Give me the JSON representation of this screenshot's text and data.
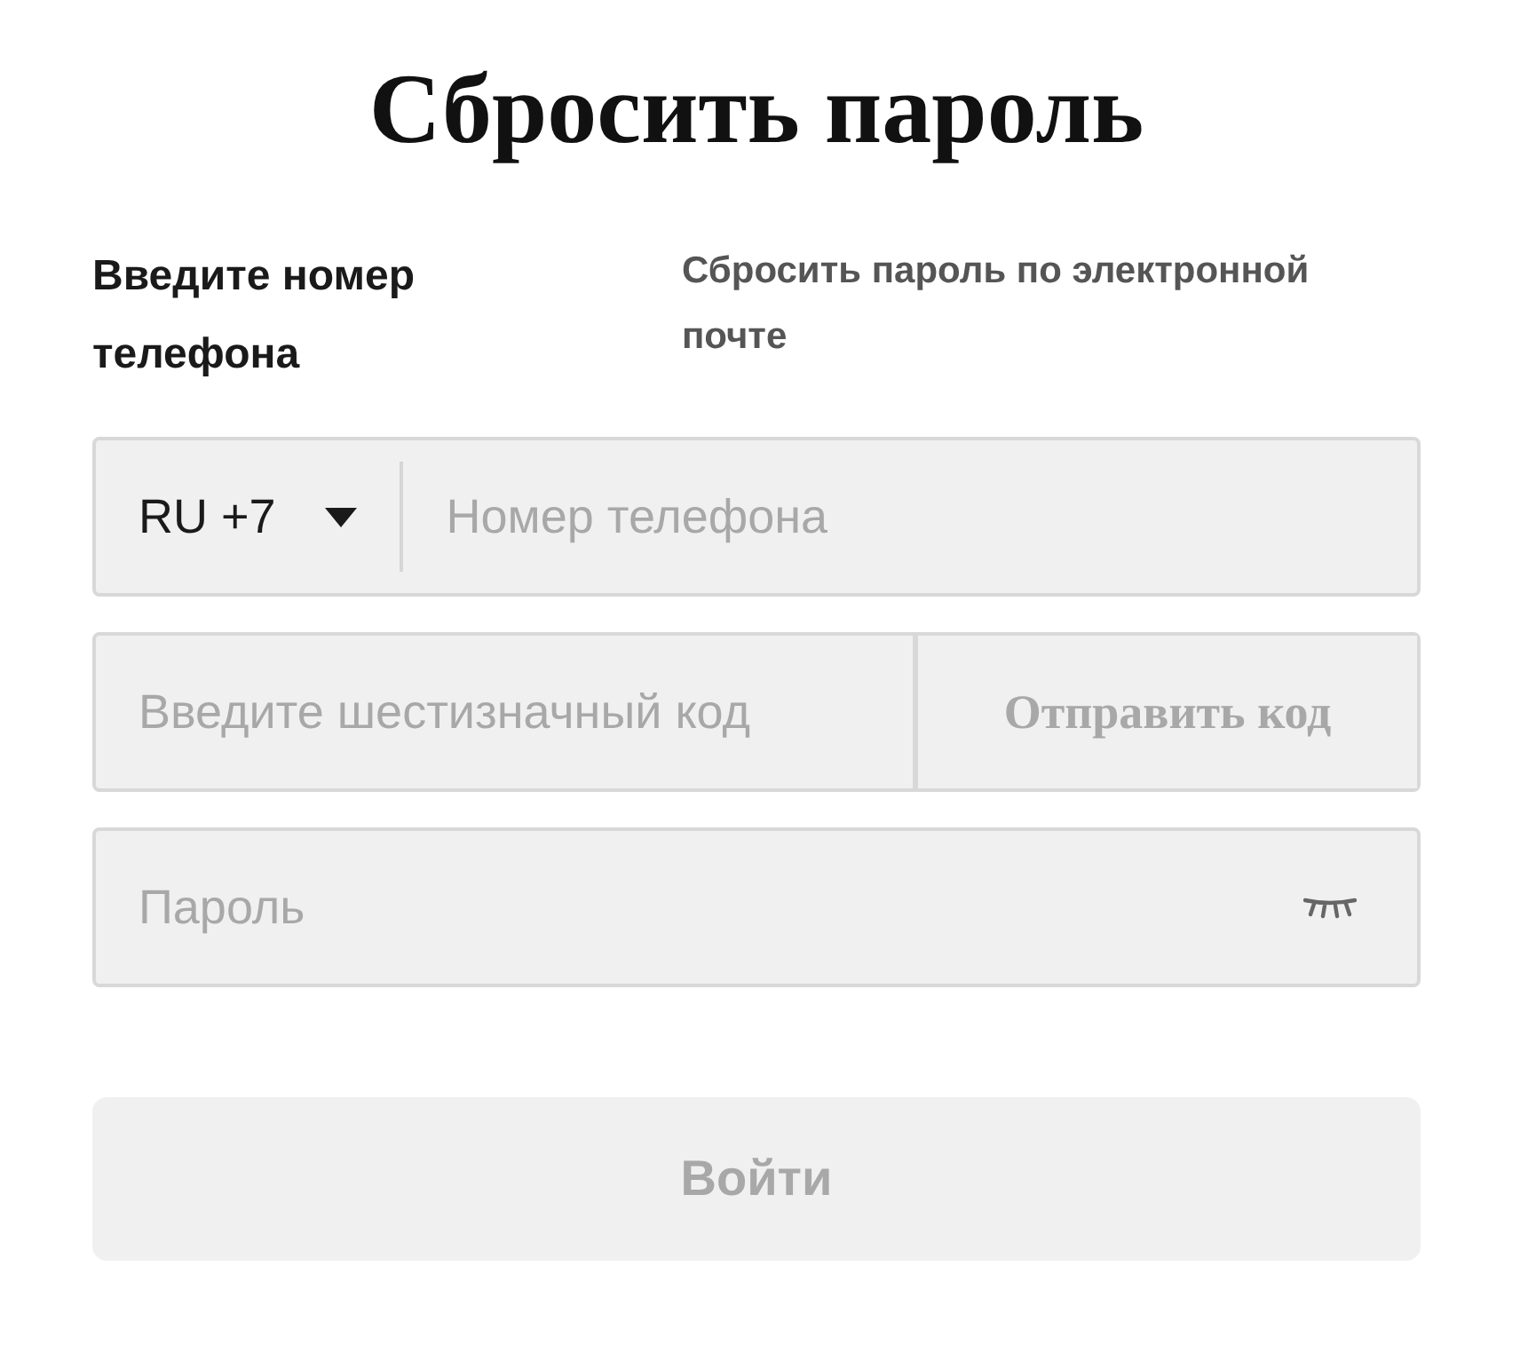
{
  "title": "Сбросить пароль",
  "tabs": [
    {
      "label": "Введите номер телефона",
      "selected": true
    },
    {
      "label": "Сбросить пароль по электронной почте",
      "selected": false
    }
  ],
  "phone": {
    "country_code": "RU +7",
    "placeholder": "Номер телефона"
  },
  "code": {
    "placeholder": "Введите шестизначный код",
    "send_button": {
      "label": "Отправить код",
      "disabled": true
    }
  },
  "password": {
    "placeholder": "Пароль",
    "visible": false
  },
  "submit": {
    "label": "Войти",
    "disabled": true
  }
}
